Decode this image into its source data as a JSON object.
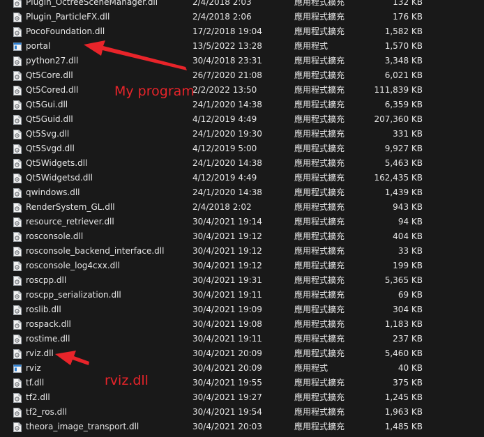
{
  "files": [
    {
      "name": "Plugin_OctreeSceneManager.dll",
      "date": "2/4/2018 2:03",
      "type": "應用程式擴充",
      "size": "132 KB",
      "icon": "dll-icon"
    },
    {
      "name": "Plugin_ParticleFX.dll",
      "date": "2/4/2018 2:06",
      "type": "應用程式擴充",
      "size": "176 KB",
      "icon": "dll-icon"
    },
    {
      "name": "PocoFoundation.dll",
      "date": "17/2/2018 19:04",
      "type": "應用程式擴充",
      "size": "1,582 KB",
      "icon": "dll-icon"
    },
    {
      "name": "portal",
      "date": "13/5/2022 13:28",
      "type": "應用程式",
      "size": "1,570 KB",
      "icon": "exe-icon"
    },
    {
      "name": "python27.dll",
      "date": "30/4/2018 23:31",
      "type": "應用程式擴充",
      "size": "3,348 KB",
      "icon": "dll-icon"
    },
    {
      "name": "Qt5Core.dll",
      "date": "26/7/2020 21:08",
      "type": "應用程式擴充",
      "size": "6,021 KB",
      "icon": "dll-icon"
    },
    {
      "name": "Qt5Cored.dll",
      "date": "2/2/2022 13:50",
      "type": "應用程式擴充",
      "size": "111,839 KB",
      "icon": "dll-icon"
    },
    {
      "name": "Qt5Gui.dll",
      "date": "24/1/2020 14:38",
      "type": "應用程式擴充",
      "size": "6,359 KB",
      "icon": "dll-icon"
    },
    {
      "name": "Qt5Guid.dll",
      "date": "4/12/2019 4:49",
      "type": "應用程式擴充",
      "size": "207,360 KB",
      "icon": "dll-icon"
    },
    {
      "name": "Qt5Svg.dll",
      "date": "24/1/2020 19:30",
      "type": "應用程式擴充",
      "size": "331 KB",
      "icon": "dll-icon"
    },
    {
      "name": "Qt5Svgd.dll",
      "date": "4/12/2019 5:00",
      "type": "應用程式擴充",
      "size": "9,927 KB",
      "icon": "dll-icon"
    },
    {
      "name": "Qt5Widgets.dll",
      "date": "24/1/2020 14:38",
      "type": "應用程式擴充",
      "size": "5,463 KB",
      "icon": "dll-icon"
    },
    {
      "name": "Qt5Widgetsd.dll",
      "date": "4/12/2019 4:49",
      "type": "應用程式擴充",
      "size": "162,435 KB",
      "icon": "dll-icon"
    },
    {
      "name": "qwindows.dll",
      "date": "24/1/2020 14:38",
      "type": "應用程式擴充",
      "size": "1,439 KB",
      "icon": "dll-icon"
    },
    {
      "name": "RenderSystem_GL.dll",
      "date": "2/4/2018 2:02",
      "type": "應用程式擴充",
      "size": "943 KB",
      "icon": "dll-icon"
    },
    {
      "name": "resource_retriever.dll",
      "date": "30/4/2021 19:14",
      "type": "應用程式擴充",
      "size": "94 KB",
      "icon": "dll-icon"
    },
    {
      "name": "rosconsole.dll",
      "date": "30/4/2021 19:12",
      "type": "應用程式擴充",
      "size": "404 KB",
      "icon": "dll-icon"
    },
    {
      "name": "rosconsole_backend_interface.dll",
      "date": "30/4/2021 19:12",
      "type": "應用程式擴充",
      "size": "33 KB",
      "icon": "dll-icon"
    },
    {
      "name": "rosconsole_log4cxx.dll",
      "date": "30/4/2021 19:12",
      "type": "應用程式擴充",
      "size": "199 KB",
      "icon": "dll-icon"
    },
    {
      "name": "roscpp.dll",
      "date": "30/4/2021 19:31",
      "type": "應用程式擴充",
      "size": "5,365 KB",
      "icon": "dll-icon"
    },
    {
      "name": "roscpp_serialization.dll",
      "date": "30/4/2021 19:11",
      "type": "應用程式擴充",
      "size": "69 KB",
      "icon": "dll-icon"
    },
    {
      "name": "roslib.dll",
      "date": "30/4/2021 19:09",
      "type": "應用程式擴充",
      "size": "304 KB",
      "icon": "dll-icon"
    },
    {
      "name": "rospack.dll",
      "date": "30/4/2021 19:08",
      "type": "應用程式擴充",
      "size": "1,183 KB",
      "icon": "dll-icon"
    },
    {
      "name": "rostime.dll",
      "date": "30/4/2021 19:11",
      "type": "應用程式擴充",
      "size": "237 KB",
      "icon": "dll-icon"
    },
    {
      "name": "rviz.dll",
      "date": "30/4/2021 20:09",
      "type": "應用程式擴充",
      "size": "5,460 KB",
      "icon": "dll-icon"
    },
    {
      "name": "rviz",
      "date": "30/4/2021 20:09",
      "type": "應用程式",
      "size": "40 KB",
      "icon": "exe-icon"
    },
    {
      "name": "tf.dll",
      "date": "30/4/2021 19:55",
      "type": "應用程式擴充",
      "size": "375 KB",
      "icon": "dll-icon"
    },
    {
      "name": "tf2.dll",
      "date": "30/4/2021 19:27",
      "type": "應用程式擴充",
      "size": "1,245 KB",
      "icon": "dll-icon"
    },
    {
      "name": "tf2_ros.dll",
      "date": "30/4/2021 19:54",
      "type": "應用程式擴充",
      "size": "1,963 KB",
      "icon": "dll-icon"
    },
    {
      "name": "theora_image_transport.dll",
      "date": "30/4/2021 20:03",
      "type": "應用程式擴充",
      "size": "1,485 KB",
      "icon": "dll-icon"
    }
  ],
  "annotations": {
    "my_program_label": "My program",
    "rviz_label": "rviz.dll",
    "color": "#e8242a"
  }
}
